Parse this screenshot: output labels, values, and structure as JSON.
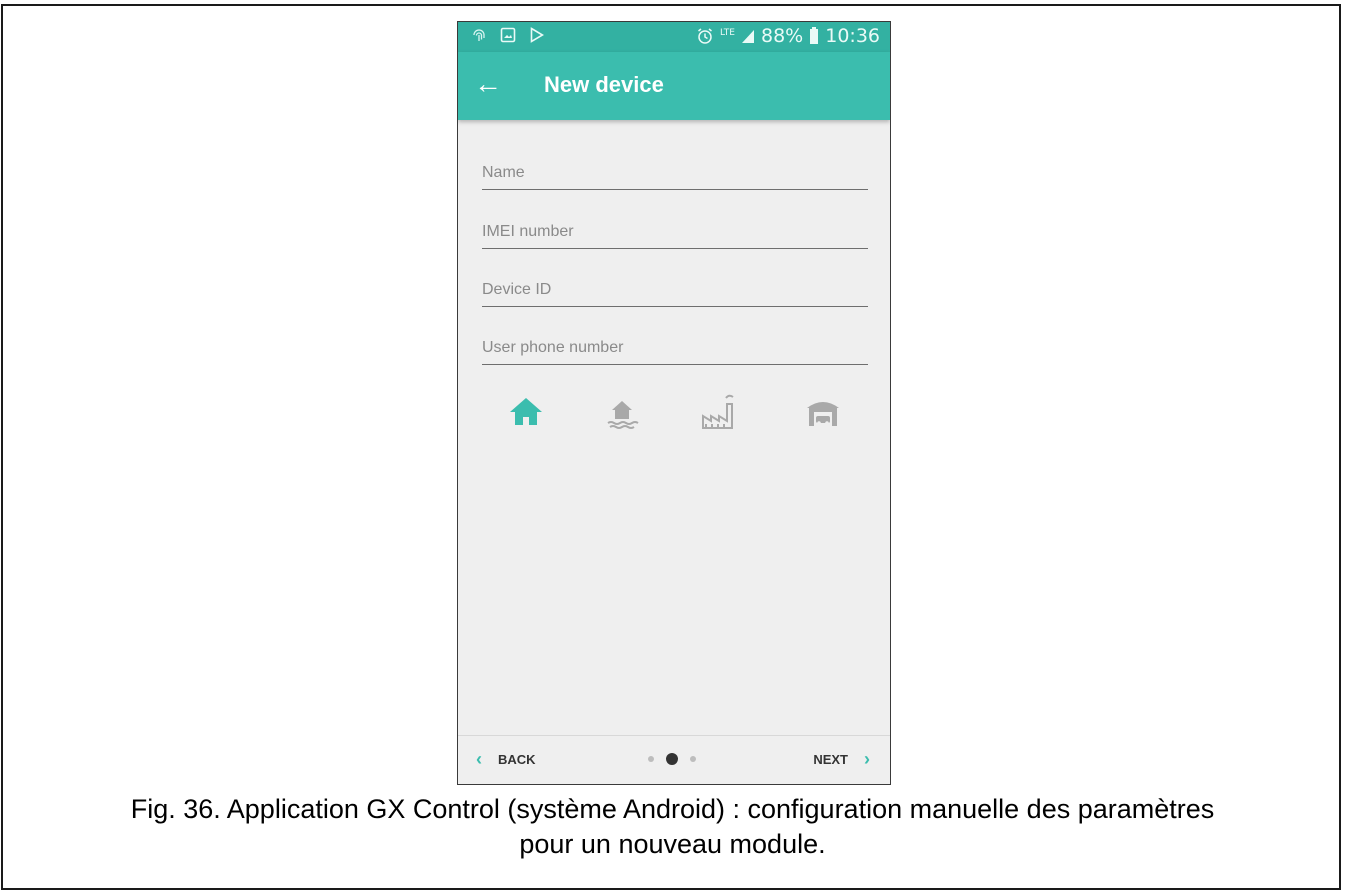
{
  "status_bar": {
    "battery": "88%",
    "time": "10:36",
    "network": "LTE",
    "icons": [
      "fingerprint-icon",
      "image-icon",
      "play-store-icon",
      "alarm-icon",
      "signal-icon",
      "battery-icon"
    ]
  },
  "app_bar": {
    "title": "New device",
    "back_icon": "arrow-back-icon"
  },
  "form": {
    "name_placeholder": "Name",
    "imei_placeholder": "IMEI number",
    "device_id_placeholder": "Device ID",
    "phone_placeholder": "User phone number"
  },
  "device_types": [
    {
      "icon": "house-icon",
      "selected": true
    },
    {
      "icon": "lake-house-icon",
      "selected": false
    },
    {
      "icon": "factory-icon",
      "selected": false
    },
    {
      "icon": "garage-icon",
      "selected": false
    }
  ],
  "bottom_nav": {
    "back_label": "BACK",
    "next_label": "NEXT",
    "pages": 3,
    "current_page": 2
  },
  "colors": {
    "accent": "#3bbdae",
    "status_bar": "#33b1a2",
    "icon_inactive": "#a9a9a9"
  },
  "caption": {
    "line1": "Fig. 36. Application GX Control (système Android) : configuration manuelle des paramètres",
    "line2": "pour un nouveau module."
  }
}
